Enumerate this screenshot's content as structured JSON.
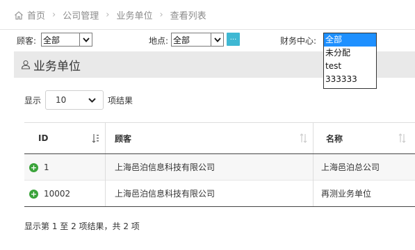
{
  "breadcrumb": {
    "items": [
      "首页",
      "公司管理",
      "业务单位",
      "查看列表"
    ],
    "home_icon": "home-icon"
  },
  "filters": {
    "customer": {
      "label": "顾客:",
      "value": "全部"
    },
    "location": {
      "label": "地点:",
      "value": "全部",
      "button_label": "..."
    },
    "finance_center": {
      "label": "财务中心:",
      "options": [
        "全部",
        "未分配",
        "test",
        "333333"
      ],
      "selected": "全部"
    }
  },
  "panel": {
    "title": "业务单位",
    "icon": "user-icon"
  },
  "length_menu": {
    "prefix": "显示",
    "value": "10",
    "suffix": "项结果"
  },
  "table": {
    "columns": [
      "ID",
      "顾客",
      "名称"
    ],
    "rows": [
      {
        "id": "1",
        "customer": "上海邑泊信息科技有限公司",
        "name": "上海邑泊总公司"
      },
      {
        "id": "10002",
        "customer": "上海邑泊信息科技有限公司",
        "name": "再测业务单位"
      }
    ]
  },
  "info": "显示第 1 至 2 项结果，共 2 项",
  "colors": {
    "accent": "#3fb8d3",
    "selected_option": "#1e90ff",
    "add_icon": "#3aa33a",
    "panel_bg": "#e9e9e9"
  }
}
